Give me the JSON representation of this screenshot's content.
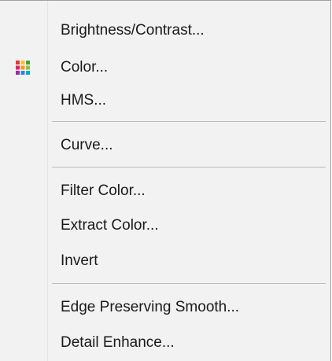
{
  "menu": {
    "items": [
      {
        "label": "Brightness/Contrast..."
      },
      {
        "label": "Color...",
        "icon": "color-grid-icon"
      },
      {
        "label": "HMS..."
      },
      {
        "label": "Curve..."
      },
      {
        "label": "Filter Color..."
      },
      {
        "label": "Extract Color..."
      },
      {
        "label": "Invert"
      },
      {
        "label": "Edge Preserving Smooth..."
      },
      {
        "label": "Detail Enhance..."
      }
    ]
  },
  "colors": {
    "menu_background": "#f2f2f2",
    "separator": "#bdbdbd",
    "border": "#a0a0a0",
    "icon_palette": [
      "#e53935",
      "#fbc02d",
      "#43a047",
      "#e91e63",
      "#ff9800",
      "#8bc34a",
      "#9c27b0",
      "#1e88e5",
      "#00acc1"
    ]
  }
}
